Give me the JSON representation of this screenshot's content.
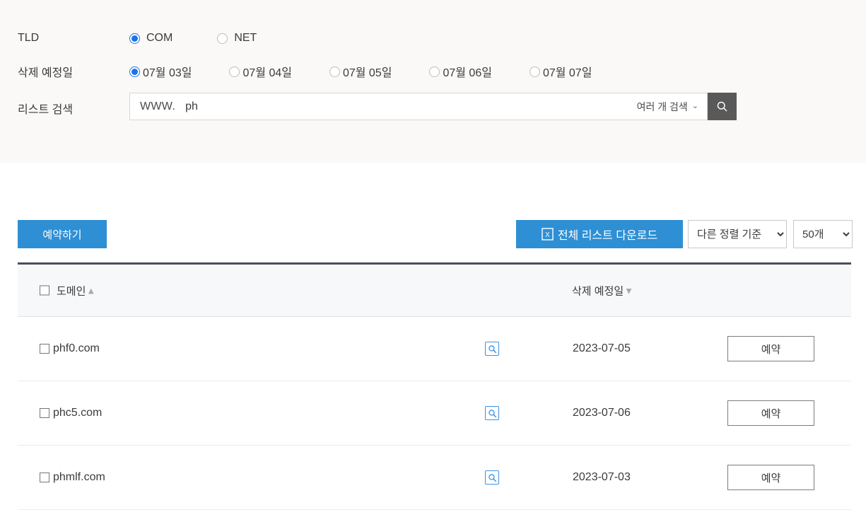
{
  "filters": {
    "tld": {
      "label": "TLD",
      "options": [
        {
          "label": "COM",
          "selected": true
        },
        {
          "label": "NET",
          "selected": false
        }
      ]
    },
    "delete_date": {
      "label": "삭제 예정일",
      "options": [
        {
          "label": "07월 03일",
          "selected": true
        },
        {
          "label": "07월 04일",
          "selected": false
        },
        {
          "label": "07월 05일",
          "selected": false
        },
        {
          "label": "07월 06일",
          "selected": false
        },
        {
          "label": "07월 07일",
          "selected": false
        }
      ]
    },
    "list_search": {
      "label": "리스트 검색",
      "prefix": "WWW.",
      "value": "ph",
      "placeholder": "",
      "multi_search_label": "여러 개 검색",
      "chevron": "⌄",
      "search_icon": "search-icon"
    }
  },
  "toolbar": {
    "reserve_all_label": "예약하기",
    "download_label": "전체 리스트 다운로드",
    "download_icon": "excel-file-icon",
    "sort_select": {
      "selected": "다른 정렬 기준",
      "options": [
        "다른 정렬 기준"
      ]
    },
    "count_select": {
      "selected": "50개",
      "options": [
        "50개"
      ]
    }
  },
  "table": {
    "headers": {
      "domain": "도메인",
      "domain_sort": "▲",
      "delete_date": "삭제 예정일",
      "delete_date_sort": "▼"
    },
    "rows": [
      {
        "domain": "phf0.com",
        "whois_icon": "whois-search-icon",
        "delete_date": "2023-07-05",
        "action_label": "예약"
      },
      {
        "domain": "phc5.com",
        "whois_icon": "whois-search-icon",
        "delete_date": "2023-07-06",
        "action_label": "예약"
      },
      {
        "domain": "phmlf.com",
        "whois_icon": "whois-search-icon",
        "delete_date": "2023-07-03",
        "action_label": "예약"
      }
    ]
  },
  "colors": {
    "accent_blue": "#2e8fd4",
    "radio_blue": "#1a73e8",
    "icon_blue": "#3d93e0",
    "search_btn_gray": "#595959",
    "panel_bg": "#faf9f7",
    "thead_bg": "#f6f8fa",
    "thead_top_border": "#4a4f57"
  }
}
